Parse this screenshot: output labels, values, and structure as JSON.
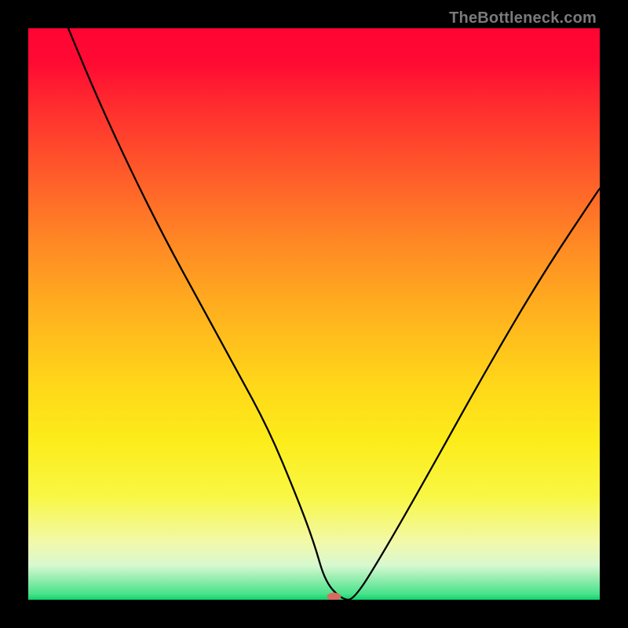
{
  "watermark": "TheBottleneck.com",
  "chart_data": {
    "type": "line",
    "title": "",
    "xlabel": "",
    "ylabel": "",
    "xlim": [
      0,
      100
    ],
    "ylim": [
      0,
      100
    ],
    "marker": {
      "x": 53.5,
      "y": 0,
      "color": "#d86b60"
    },
    "series": [
      {
        "name": "curve",
        "x": [
          7,
          12,
          18,
          24,
          30,
          36,
          42,
          47,
          50,
          52,
          55,
          57,
          62,
          70,
          80,
          90,
          100
        ],
        "values": [
          100,
          88,
          75,
          63,
          52,
          41,
          30,
          18,
          10,
          3,
          0,
          0,
          8,
          22,
          40,
          57,
          72
        ]
      }
    ]
  }
}
